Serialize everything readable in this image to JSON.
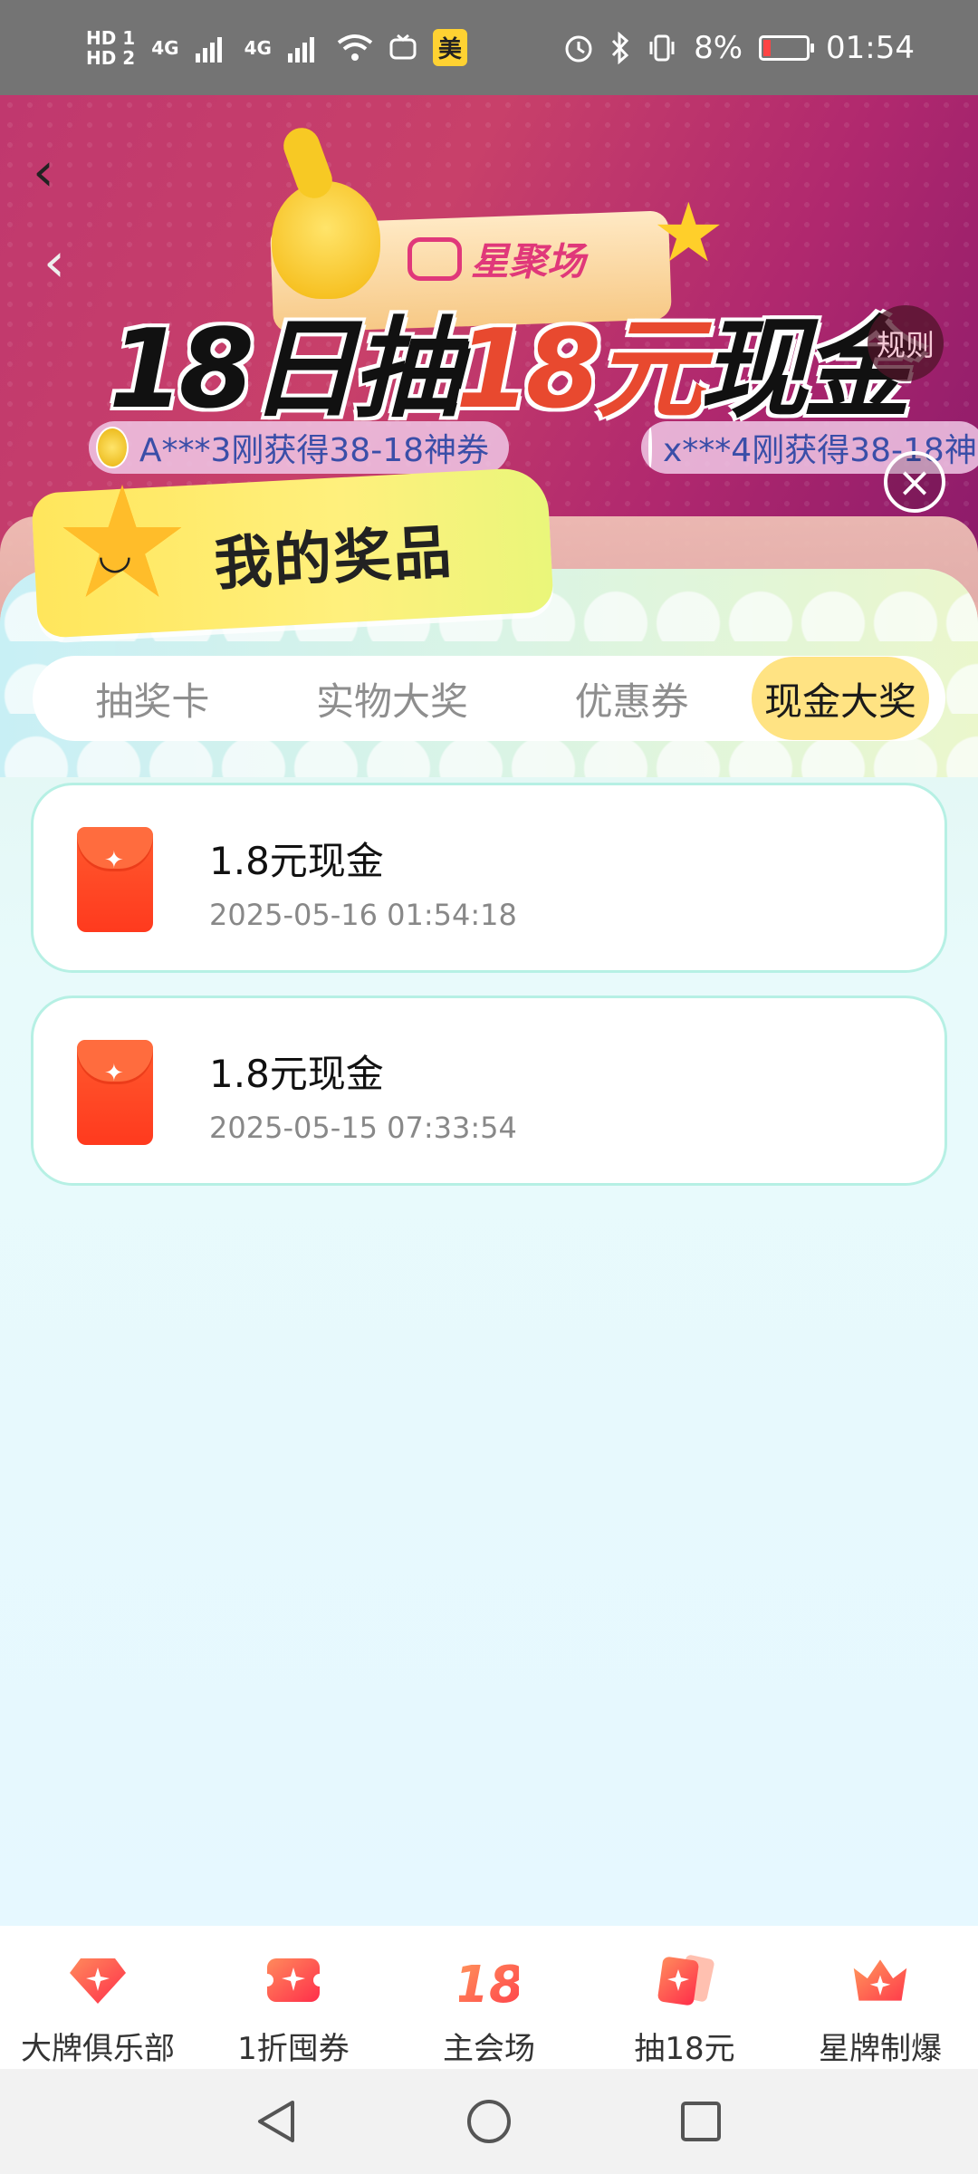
{
  "status_bar": {
    "left_labels": [
      "HD 1",
      "HD 2",
      "4G",
      "4G"
    ],
    "app_badge": "美",
    "battery_percent": "8%",
    "time": "01:54",
    "icons": [
      "signal-icon",
      "wifi-icon",
      "tv-icon",
      "alarm-icon",
      "bluetooth-icon",
      "vibrate-icon",
      "battery-icon"
    ]
  },
  "banner": {
    "sub_logo": "星聚场",
    "title_part1": "18日抽",
    "title_accent": "18元",
    "title_part2": "现金",
    "rules_label": "规则",
    "ticker": [
      "A***3刚获得38-18神券",
      "x***4刚获得38-18神"
    ]
  },
  "modal": {
    "title": "我的奖品",
    "tabs": [
      {
        "label": "抽奖卡"
      },
      {
        "label": "实物大奖"
      },
      {
        "label": "优惠券"
      },
      {
        "label": "现金大奖"
      }
    ],
    "active_tab": "现金大奖",
    "prizes": [
      {
        "name": "1.8元现金",
        "time": "2025-05-16 01:54:18"
      },
      {
        "name": "1.8元现金",
        "time": "2025-05-15 07:33:54"
      }
    ]
  },
  "bottom_nav": [
    {
      "label": "大牌俱乐部",
      "icon": "diamond-icon"
    },
    {
      "label": "1折囤券",
      "icon": "coupon-icon"
    },
    {
      "label": "主会场",
      "icon": "eighteen-icon"
    },
    {
      "label": "抽18元",
      "icon": "card-icon"
    },
    {
      "label": "星牌制爆",
      "icon": "crown-icon"
    }
  ],
  "colors": {
    "accent": "#e8492f",
    "active_tab_bg": "#ffe383",
    "envelope": "#ff3a1e",
    "nav_icon": "#ff5a3c"
  }
}
